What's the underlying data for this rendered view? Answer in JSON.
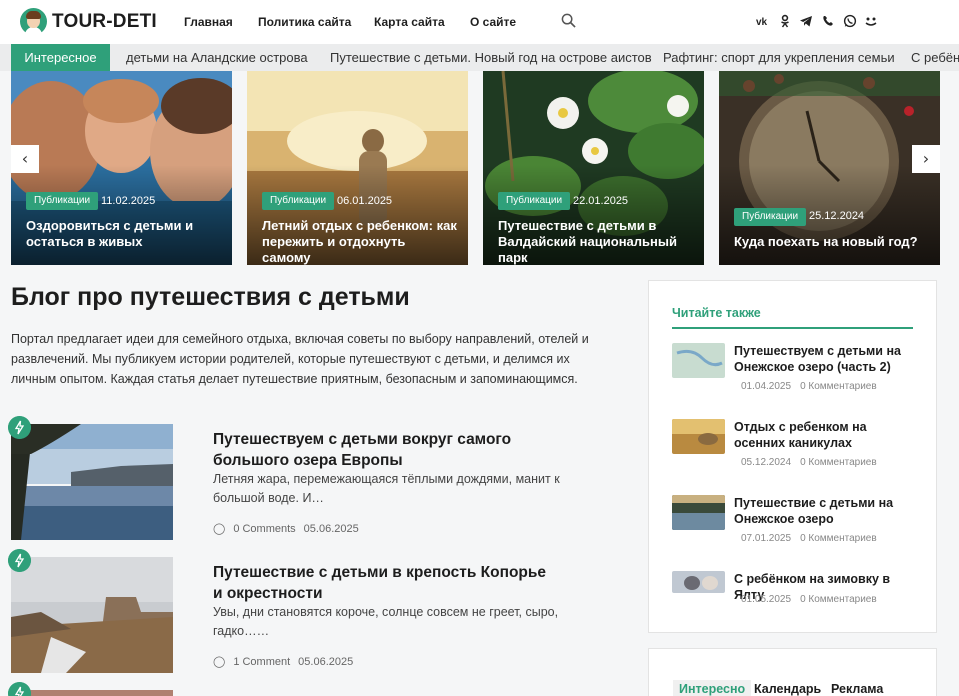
{
  "site": {
    "logo_text": "TOUR-DETI",
    "nav": [
      "Главная",
      "Политика сайта",
      "Карта сайта",
      "О сайте"
    ]
  },
  "social_icons": [
    "vk-icon",
    "odnoklassniki-icon",
    "telegram-icon",
    "viber-icon",
    "whatsapp-icon",
    "moimir-icon"
  ],
  "ticker": {
    "label": "Интересное",
    "items": [
      "детьми на Аландские острова",
      "Путешествие с детьми. Новый год на острове аистов",
      "Рафтинг: спорт для укрепления семьи",
      "С ребёнком"
    ]
  },
  "slides": [
    {
      "tag": "Публикации",
      "date": "11.02.2025",
      "title": "Оздоровиться с детьми и остаться в живых"
    },
    {
      "tag": "Публикации",
      "date": "06.01.2025",
      "title": "Летний отдых с ребенком: как пережить и отдохнуть самому"
    },
    {
      "tag": "Публикации",
      "date": "22.01.2025",
      "title": "Путешествие с детьми в Валдайский национальный парк"
    },
    {
      "tag": "Публикации",
      "date": "25.12.2024",
      "title": "Куда поехать на новый год?"
    }
  ],
  "main": {
    "title": "Блог про путешествия с детьми",
    "intro": "Портал предлагает идеи для семейного отдыха, включая советы по выбору направлений, отелей и развлечений. Мы публикуем истории родителей, которые путешествуют с детьми, и делимся их личным опытом. Каждая статья делает путешествие приятным, безопасным и запоминающимся."
  },
  "posts": [
    {
      "title": "Путешествуем с детьми вокруг самого большого озера Европы",
      "excerpt": "Летняя жара, перемежающаяся тёплыми дождями, манит к большой воде. И…",
      "comments": "0 Comments",
      "date": "05.06.2025"
    },
    {
      "title": "Путешествие с детьми в крепость Копорье и окрестности",
      "excerpt": "Увы, дни становятся короче, солнце совсем не греет, сыро, гадко……",
      "comments": "1 Comment",
      "date": "05.06.2025"
    }
  ],
  "sidebar": {
    "title": "Читайте также",
    "items": [
      {
        "title": "Путешествуем с детьми на Онежское озеро (часть 2)",
        "date": "01.04.2025",
        "comments": "0 Комментариев"
      },
      {
        "title": "Отдых с ребенком на осенних каникулах",
        "date": "05.12.2024",
        "comments": "0 Комментариев"
      },
      {
        "title": "Путешествие с детьми на Онежское озеро",
        "date": "07.01.2025",
        "comments": "0 Комментариев"
      },
      {
        "title": "С ребёнком на зимовку в Ялту",
        "date": "01.05.2025",
        "comments": "0 Комментариев"
      }
    ],
    "tabs": [
      "Интересно",
      "Календарь",
      "Реклама"
    ]
  },
  "colors": {
    "accent": "#2fa07a"
  }
}
